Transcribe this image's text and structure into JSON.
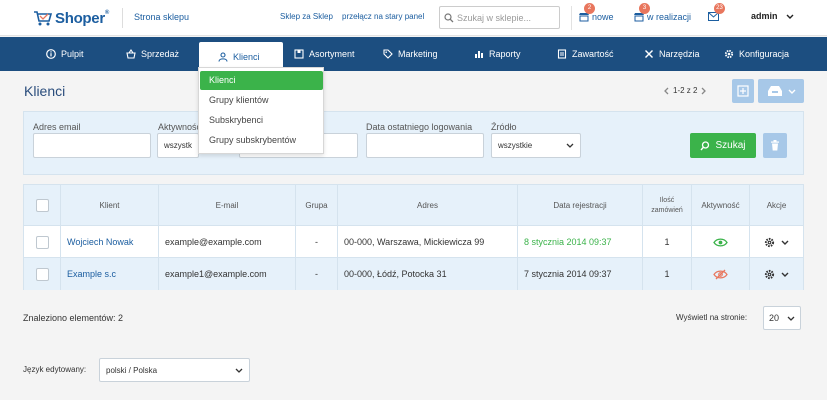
{
  "brand": {
    "name": "Shoper",
    "mark": "®"
  },
  "topbar": {
    "store_link": "Strona sklepu",
    "link_skins": "Sklep za Sklep",
    "link_old_panel": "przełącz na stary panel",
    "search_placeholder": "Szukaj w sklepie...",
    "notifications": [
      {
        "label": "nowe",
        "count": "2"
      },
      {
        "label": "w realizacji",
        "count": "3"
      },
      {
        "label": "",
        "count": "23"
      }
    ],
    "user": "admin"
  },
  "nav": {
    "items": [
      {
        "label": "Pulpit",
        "icon": "info-icon"
      },
      {
        "label": "Sprzedaż",
        "icon": "basket-icon"
      },
      {
        "label": "Klienci",
        "icon": "users-icon"
      },
      {
        "label": "Asortyment",
        "icon": "box-icon"
      },
      {
        "label": "Marketing",
        "icon": "tag-icon"
      },
      {
        "label": "Raporty",
        "icon": "bar-chart-icon"
      },
      {
        "label": "Zawartość",
        "icon": "document-icon"
      },
      {
        "label": "Narzędzia",
        "icon": "tools-icon"
      },
      {
        "label": "Konfiguracja",
        "icon": "gear-icon"
      }
    ]
  },
  "dropdown": {
    "items": [
      {
        "label": "Klienci"
      },
      {
        "label": "Grupy klientów"
      },
      {
        "label": "Subskrybenci"
      },
      {
        "label": "Grupy subskrybentów"
      }
    ]
  },
  "page": {
    "title": "Klienci",
    "pager_text": "1-2 z 2"
  },
  "filters": {
    "email_label": "Adres email",
    "activity_label": "Aktywność",
    "activity_value": "wszystkie",
    "last_login_label": "Data ostatniego logowania",
    "source_label": "Źródło",
    "source_value": "wszystkie",
    "search_button": "Szukaj"
  },
  "table": {
    "headers": {
      "client": "Klient",
      "email": "E-mail",
      "group": "Grupa",
      "address": "Adres",
      "registered": "Data rejestracji",
      "orders_line1": "Ilość",
      "orders_line2": "zamówień",
      "activity": "Aktywność",
      "actions": "Akcje"
    },
    "rows": [
      {
        "client": "Wojciech Nowak",
        "email": "example@example.com",
        "group": "-",
        "address": "00-000, Warszawa, Mickiewicza 99",
        "registered": "8 stycznia 2014 09:37",
        "orders": "1",
        "active": true
      },
      {
        "client": "Example s.c",
        "email": "example1@example.com",
        "group": "-",
        "address": "00-000, Łódź, Potocka 31",
        "registered": "7 stycznia 2014 09:37",
        "orders": "1",
        "active": false
      }
    ]
  },
  "footer": {
    "found": "Znaleziono elementów: 2",
    "per_page_label": "Wyświetl na stronie:",
    "per_page_value": "20",
    "lang_label": "Język edytowany:",
    "lang_value": "polski / Polska"
  },
  "colors": {
    "nav_bg": "#1c4e80",
    "link": "#1c5ea0",
    "success": "#3bb34a",
    "badge": "#e8765d",
    "inactive": "#e8765d",
    "light_button": "#a7c8e8",
    "panel": "#e6f1fa"
  }
}
